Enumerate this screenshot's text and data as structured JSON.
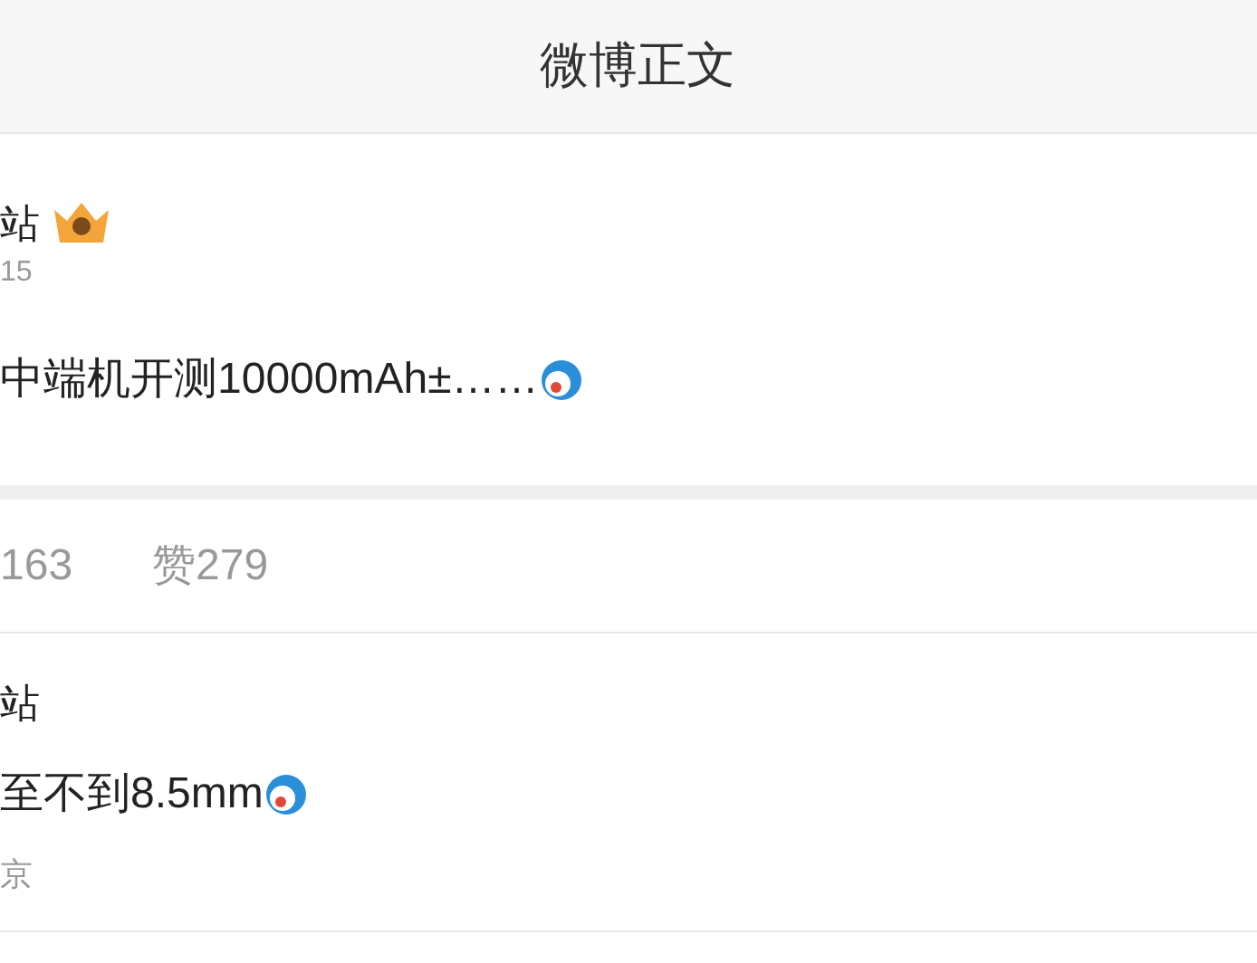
{
  "header": {
    "title": "微博正文"
  },
  "post": {
    "author": "站",
    "time": "15",
    "text": "中端机开测10000mAh±……"
  },
  "stats": [
    {
      "label": "163"
    },
    {
      "label": "赞279"
    }
  ],
  "comment": {
    "author": "站",
    "text": "至不到8.5mm",
    "location": "京"
  }
}
